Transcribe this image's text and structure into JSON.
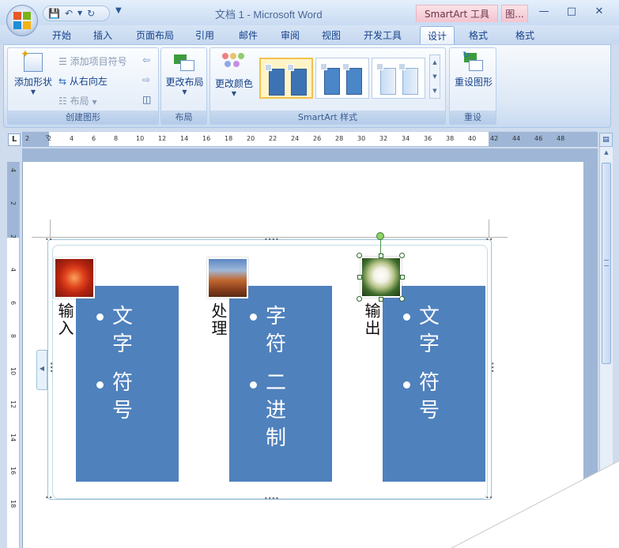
{
  "window": {
    "title": "文档 1 - Microsoft Word",
    "context_tab_smartart": "SmartArt 工具",
    "context_tab_picture": "图..."
  },
  "tabs": [
    "开始",
    "插入",
    "页面布局",
    "引用",
    "邮件",
    "审阅",
    "视图",
    "开发工具",
    "设计",
    "格式",
    "格式"
  ],
  "active_tab": "设计",
  "ribbon": {
    "create_group": {
      "label": "创建图形",
      "add_shape": "添加形状",
      "add_bullet": "添加项目符号",
      "right_to_left": "从右向左",
      "layout": "布局"
    },
    "layout_group": {
      "label": "布局",
      "change_layout": "更改布局"
    },
    "styles_group": {
      "label": "SmartArt 样式",
      "change_color": "更改颜色"
    },
    "reset_group": {
      "label": "重设",
      "reset_graphic": "重设图形"
    }
  },
  "ruler": {
    "horizontal": [
      "2",
      "2",
      "4",
      "6",
      "8",
      "10",
      "12",
      "14",
      "16",
      "18",
      "20",
      "22",
      "24",
      "26",
      "28",
      "30",
      "32",
      "34",
      "36",
      "38",
      "40",
      "42",
      "44",
      "46",
      "48"
    ],
    "vertical": [
      "4",
      "2",
      "2",
      "4",
      "6",
      "8",
      "10",
      "12",
      "14",
      "16",
      "18"
    ]
  },
  "smartart": {
    "columns": [
      {
        "label": "输入",
        "bullets": [
          "文字",
          "符号"
        ],
        "image": "red-flower"
      },
      {
        "label": "处理",
        "bullets": [
          "字符",
          "二进制"
        ],
        "image": "desert-canyon"
      },
      {
        "label": "输出",
        "bullets": [
          "文字",
          "符号"
        ],
        "image": "white-flower"
      }
    ],
    "fill_color": "#4f81bd"
  },
  "icons": {
    "office": "office-button-icon",
    "save": "save-icon",
    "undo": "undo-icon",
    "redo": "redo-icon",
    "help": "help-icon",
    "minimize": "minimize-icon",
    "maximize": "maximize-icon",
    "close": "close-icon"
  }
}
